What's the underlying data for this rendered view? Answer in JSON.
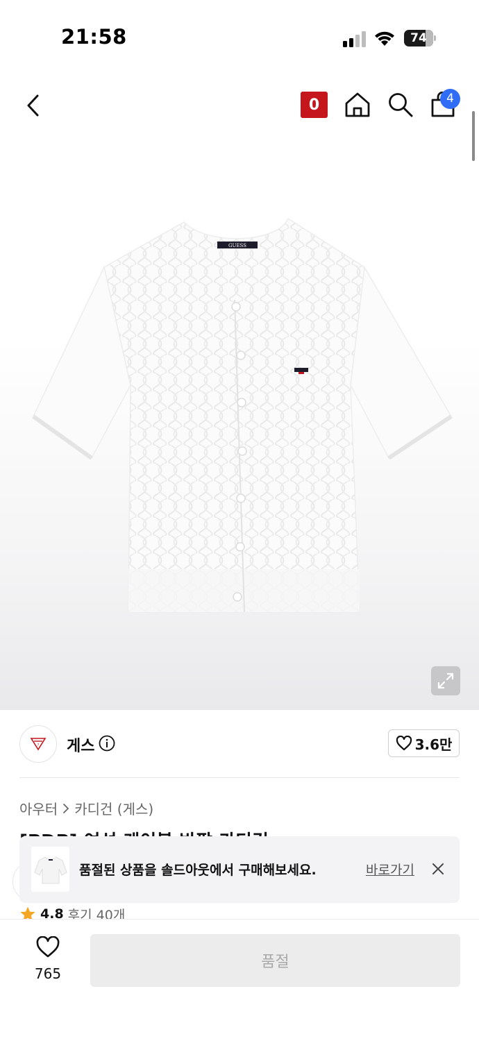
{
  "status_bar": {
    "time": "21:58",
    "battery_level": "74",
    "battery_fraction": 0.74,
    "icons": [
      "signal-icon",
      "wifi-icon",
      "battery-icon"
    ]
  },
  "nav": {
    "back_icon": "chevron-left-icon",
    "o_badge": "0",
    "home_icon": "home-icon",
    "search_icon": "search-icon",
    "cart_icon": "shopping-bag-icon",
    "cart_count": "4"
  },
  "gallery": {
    "product_image": "white short-sleeve cable knit cardigan",
    "garment_label": "GUESS",
    "expand_icon": "expand-icon"
  },
  "brand": {
    "name": "게스",
    "info_icon": "info-icon",
    "likes": "3.6만"
  },
  "breadcrumb": {
    "category": "아우터",
    "subcategory": "카디건 (게스)"
  },
  "product": {
    "title": "[PDP] 여성 케이블 반팔 카디건"
  },
  "rating": {
    "score": "4.8",
    "reviews": "후기 40개"
  },
  "banner": {
    "message": "품절된 상품을 솔드아웃에서 구매해보세요.",
    "link_label": "바로가기",
    "close_icon": "close-icon"
  },
  "bottom_bar": {
    "wish_count": "765",
    "action_label": "품절"
  },
  "colors": {
    "accent_red": "#c4161c",
    "badge_blue": "#2f6df6",
    "star_orange": "#f5a623"
  }
}
